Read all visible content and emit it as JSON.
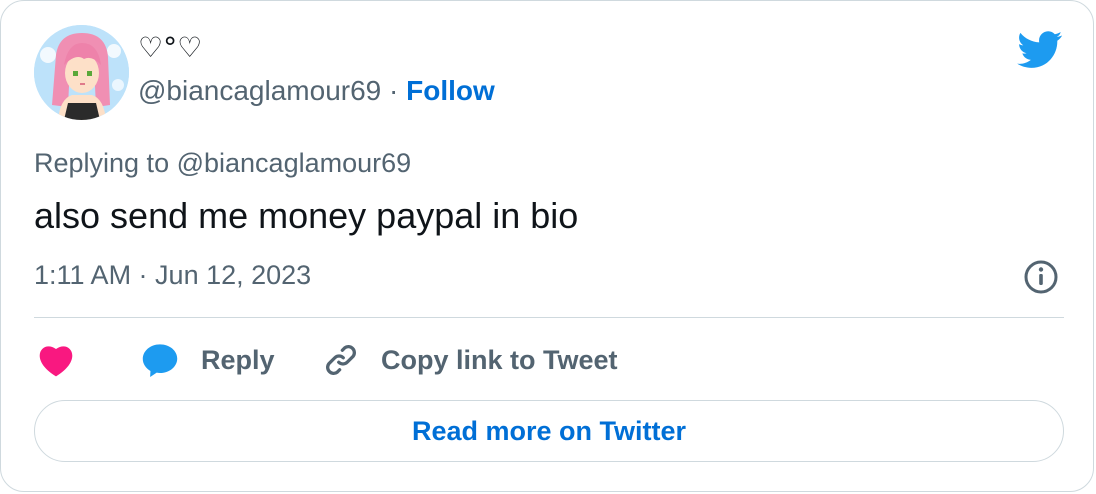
{
  "user": {
    "display_name": "♡°♡",
    "handle": "@biancaglamour69",
    "separator": " · ",
    "follow_label": "Follow"
  },
  "tweet": {
    "replying_prefix": "Replying to ",
    "replying_to": "@biancaglamour69",
    "text": "also send me money paypal in bio",
    "timestamp": "1:11 AM · Jun 12, 2023"
  },
  "actions": {
    "reply_label": "Reply",
    "copy_link_label": "Copy link to Tweet"
  },
  "footer": {
    "read_more_label": "Read more on Twitter"
  },
  "icons": {
    "brand": "twitter-bird-icon",
    "info": "info-icon",
    "like": "heart-icon",
    "reply": "speech-bubble-icon",
    "copy": "link-icon"
  },
  "colors": {
    "twitter_blue": "#1d9bf0",
    "link_blue": "#006fd6",
    "heart_pink": "#f91880",
    "text_primary": "#0f1419",
    "text_secondary": "#536471",
    "border": "#cfd9de"
  }
}
